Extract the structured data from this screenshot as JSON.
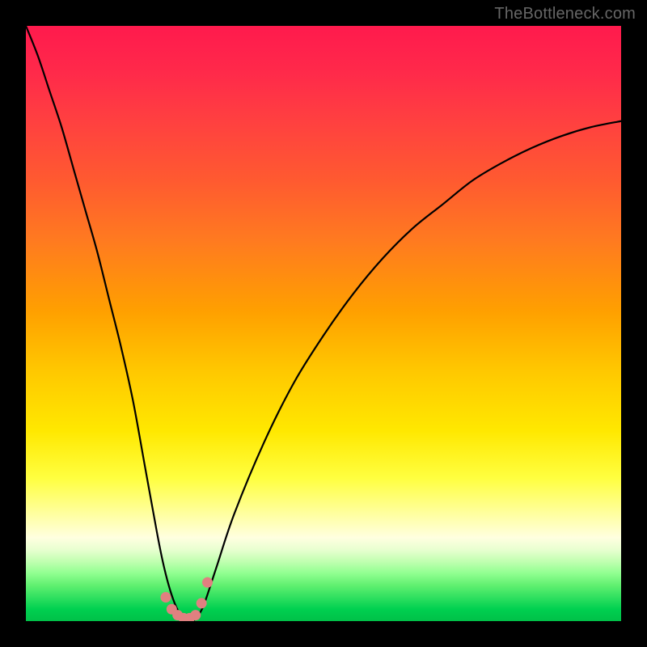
{
  "credit": "TheBottleneck.com",
  "chart_data": {
    "type": "line",
    "title": "",
    "xlabel": "",
    "ylabel": "",
    "xlim": [
      0,
      100
    ],
    "ylim": [
      0,
      100
    ],
    "grid": false,
    "series": [
      {
        "name": "bottleneck-curve",
        "x": [
          0,
          2,
          4,
          6,
          8,
          10,
          12,
          14,
          16,
          18,
          20,
          22,
          23,
          24,
          25,
          26,
          27,
          28,
          29,
          30,
          32,
          35,
          40,
          45,
          50,
          55,
          60,
          65,
          70,
          75,
          80,
          85,
          90,
          95,
          100
        ],
        "y": [
          100,
          95,
          89,
          83,
          76,
          69,
          62,
          54,
          46,
          37,
          26,
          15,
          10,
          6,
          3,
          1,
          0,
          0,
          1,
          3,
          9,
          18,
          30,
          40,
          48,
          55,
          61,
          66,
          70,
          74,
          77,
          79.5,
          81.5,
          83,
          84
        ]
      }
    ],
    "markers": {
      "name": "highlight-points",
      "x": [
        23.5,
        24.5,
        25.5,
        26.5,
        27.5,
        28.5,
        29.5,
        30.5
      ],
      "y": [
        4.0,
        2.0,
        1.0,
        0.5,
        0.5,
        1.0,
        3.0,
        6.5
      ]
    },
    "background_gradient": {
      "top": "#ff1a4d",
      "mid": "#ffc800",
      "bottom": "#00c048"
    }
  }
}
